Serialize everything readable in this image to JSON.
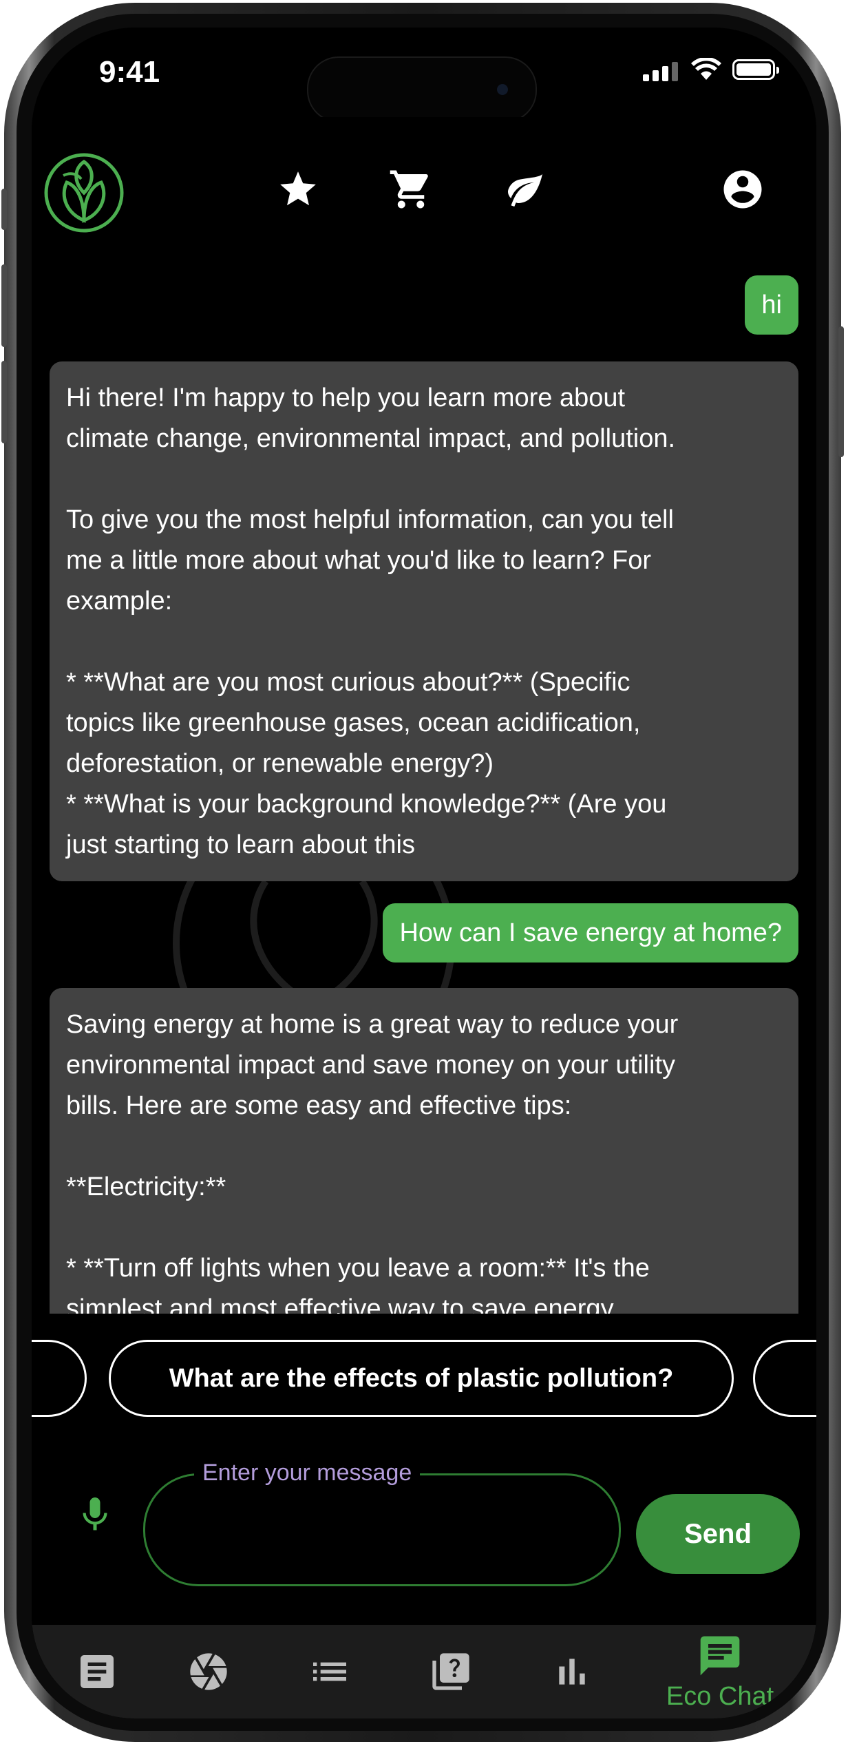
{
  "status_bar": {
    "time": "9:41"
  },
  "top_nav": {
    "icons": [
      "app-logo",
      "star-icon",
      "cart-icon",
      "leaf-icon",
      "account-icon"
    ]
  },
  "chat": {
    "messages": [
      {
        "role": "user",
        "text": "hi"
      },
      {
        "role": "bot",
        "text": "Hi there! I'm happy to help you learn more about\nclimate change, environmental impact, and pollution.\n\nTo give you the most helpful information, can you tell\nme a little more about what you'd like to learn? For\nexample:\n\n* **What are you most curious about?** (Specific\ntopics like greenhouse gases, ocean acidification,\ndeforestation, or renewable energy?)\n* **What is your background knowledge?** (Are you\njust starting to learn about this"
      },
      {
        "role": "user",
        "text": "How can I save energy at home?"
      },
      {
        "role": "bot",
        "text": "Saving energy at home is a great way to reduce your\nenvironmental impact and save money on your utility\nbills. Here are some easy and effective tips:\n\n**Electricity:**\n\n* **Turn off lights when you leave a room:** It's the\nsimplest and most effective way to save energy."
      }
    ]
  },
  "suggestions": {
    "chips": [
      "What are the effects of plastic pollution?"
    ]
  },
  "composer": {
    "label": "Enter your message",
    "value": "",
    "send_label": "Send"
  },
  "bottom_nav": {
    "items": [
      {
        "icon": "article-icon",
        "label": ""
      },
      {
        "icon": "camera-shutter-icon",
        "label": ""
      },
      {
        "icon": "list-icon",
        "label": ""
      },
      {
        "icon": "quiz-icon",
        "label": ""
      },
      {
        "icon": "bar-chart-icon",
        "label": ""
      },
      {
        "icon": "chat-icon",
        "label": "Eco Chat",
        "active": true
      }
    ]
  },
  "colors": {
    "accent": "#4caf50",
    "accent_dark": "#388e3c",
    "bot_bubble": "#424242",
    "nav_bg": "#1c1c1c",
    "label_purple": "#b39ddb"
  }
}
